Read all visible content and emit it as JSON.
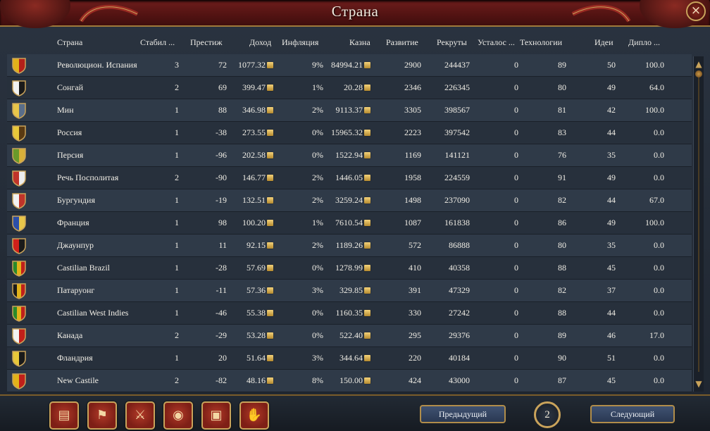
{
  "window": {
    "title": "Страна"
  },
  "columns": [
    "Страна",
    "Стабил ...",
    "Престиж",
    "Доход",
    "Инфляция",
    "Казна",
    "Развитие",
    "Рекруты",
    "Усталос ...",
    "Технологии",
    "Идеи",
    "Дипло ..."
  ],
  "rows": [
    {
      "country": "Революцион. Испания",
      "stability": "3",
      "prestige": "72",
      "income": "1077.32",
      "inflation": "9%",
      "treasury": "84994.21",
      "development": "2900",
      "manpower": "244437",
      "war_exhaustion": "0",
      "tech": "89",
      "ideas": "50",
      "diplo": "100.0",
      "flag_colors": [
        "#e2b21a",
        "#b3201a"
      ]
    },
    {
      "country": "Сонгай",
      "stability": "2",
      "prestige": "69",
      "income": "399.47",
      "inflation": "1%",
      "treasury": "20.28",
      "development": "2346",
      "manpower": "226345",
      "war_exhaustion": "0",
      "tech": "80",
      "ideas": "49",
      "diplo": "64.0",
      "flag_colors": [
        "#f2f2f2",
        "#1a1a1a"
      ]
    },
    {
      "country": "Мин",
      "stability": "1",
      "prestige": "88",
      "income": "346.98",
      "inflation": "2%",
      "treasury": "9113.37",
      "development": "3305",
      "manpower": "398567",
      "war_exhaustion": "0",
      "tech": "81",
      "ideas": "42",
      "diplo": "100.0",
      "flag_colors": [
        "#e8c64a",
        "#5a6e8a"
      ]
    },
    {
      "country": "Россия",
      "stability": "1",
      "prestige": "-38",
      "income": "273.55",
      "inflation": "0%",
      "treasury": "15965.32",
      "development": "2223",
      "manpower": "397542",
      "war_exhaustion": "0",
      "tech": "83",
      "ideas": "44",
      "diplo": "0.0",
      "flag_colors": [
        "#e8c83a",
        "#5a3a12"
      ]
    },
    {
      "country": "Персия",
      "stability": "1",
      "prestige": "-96",
      "income": "202.58",
      "inflation": "0%",
      "treasury": "1522.94",
      "development": "1169",
      "manpower": "141121",
      "war_exhaustion": "0",
      "tech": "76",
      "ideas": "35",
      "diplo": "0.0",
      "flag_colors": [
        "#6a9a2a",
        "#d8b03a"
      ]
    },
    {
      "country": "Речь Посполитая",
      "stability": "2",
      "prestige": "-90",
      "income": "146.77",
      "inflation": "2%",
      "treasury": "1446.05",
      "development": "1958",
      "manpower": "224559",
      "war_exhaustion": "0",
      "tech": "91",
      "ideas": "49",
      "diplo": "0.0",
      "flag_colors": [
        "#c0342a",
        "#ededed"
      ]
    },
    {
      "country": "Бургундия",
      "stability": "1",
      "prestige": "-19",
      "income": "132.51",
      "inflation": "2%",
      "treasury": "3259.24",
      "development": "1498",
      "manpower": "237090",
      "war_exhaustion": "0",
      "tech": "82",
      "ideas": "44",
      "diplo": "67.0",
      "flag_colors": [
        "#f2f2f2",
        "#c0342a"
      ]
    },
    {
      "country": "Франция",
      "stability": "1",
      "prestige": "98",
      "income": "100.20",
      "inflation": "1%",
      "treasury": "7610.54",
      "development": "1087",
      "manpower": "161838",
      "war_exhaustion": "0",
      "tech": "86",
      "ideas": "49",
      "diplo": "100.0",
      "flag_colors": [
        "#2c4fa8",
        "#e8c64a"
      ]
    },
    {
      "country": "Джаунпур",
      "stability": "1",
      "prestige": "11",
      "income": "92.15",
      "inflation": "2%",
      "treasury": "1189.26",
      "development": "572",
      "manpower": "86888",
      "war_exhaustion": "0",
      "tech": "80",
      "ideas": "35",
      "diplo": "0.0",
      "flag_colors": [
        "#d0201a",
        "#1a1a1a"
      ]
    },
    {
      "country": "Castilian Brazil",
      "stability": "1",
      "prestige": "-28",
      "income": "57.69",
      "inflation": "0%",
      "treasury": "1278.99",
      "development": "410",
      "manpower": "40358",
      "war_exhaustion": "0",
      "tech": "88",
      "ideas": "45",
      "diplo": "0.0",
      "flag_colors": [
        "#2a8a2a",
        "#e2b21a",
        "#c0201a"
      ]
    },
    {
      "country": "Патаруонг",
      "stability": "1",
      "prestige": "-11",
      "income": "57.36",
      "inflation": "3%",
      "treasury": "329.85",
      "development": "391",
      "manpower": "47329",
      "war_exhaustion": "0",
      "tech": "82",
      "ideas": "37",
      "diplo": "0.0",
      "flag_colors": [
        "#1a1a1a",
        "#e2b21a",
        "#c0201a"
      ]
    },
    {
      "country": "Castilian West Indies",
      "stability": "1",
      "prestige": "-46",
      "income": "55.38",
      "inflation": "0%",
      "treasury": "1160.35",
      "development": "330",
      "manpower": "27242",
      "war_exhaustion": "0",
      "tech": "88",
      "ideas": "44",
      "diplo": "0.0",
      "flag_colors": [
        "#2a8a2a",
        "#e2b21a",
        "#c0201a"
      ]
    },
    {
      "country": "Канада",
      "stability": "2",
      "prestige": "-29",
      "income": "53.28",
      "inflation": "0%",
      "treasury": "522.40",
      "development": "295",
      "manpower": "29376",
      "war_exhaustion": "0",
      "tech": "89",
      "ideas": "46",
      "diplo": "17.0",
      "flag_colors": [
        "#f2f2f2",
        "#c0201a"
      ]
    },
    {
      "country": "Фландрия",
      "stability": "1",
      "prestige": "20",
      "income": "51.64",
      "inflation": "3%",
      "treasury": "344.64",
      "development": "220",
      "manpower": "40184",
      "war_exhaustion": "0",
      "tech": "90",
      "ideas": "51",
      "diplo": "0.0",
      "flag_colors": [
        "#e8c83a",
        "#1a1a1a"
      ]
    },
    {
      "country": "New Castile",
      "stability": "2",
      "prestige": "-82",
      "income": "48.16",
      "inflation": "8%",
      "treasury": "150.00",
      "development": "424",
      "manpower": "43000",
      "war_exhaustion": "0",
      "tech": "87",
      "ideas": "45",
      "diplo": "0.0",
      "flag_colors": [
        "#e2b21a",
        "#c0201a"
      ]
    }
  ],
  "bottom": {
    "prev_label": "Предыдущий",
    "next_label": "Следующий",
    "page": "2",
    "tabs": [
      {
        "icon": "ledger-icon"
      },
      {
        "icon": "flag-icon"
      },
      {
        "icon": "crossed-swords-icon"
      },
      {
        "icon": "coins-icon"
      },
      {
        "icon": "trade-goods-icon"
      },
      {
        "icon": "handshake-icon"
      }
    ]
  },
  "colors": {
    "title_bar": "#5a1614",
    "gold_trim": "#c9a35b",
    "row_odd": "#2f3a48",
    "row_even": "#27303c"
  }
}
